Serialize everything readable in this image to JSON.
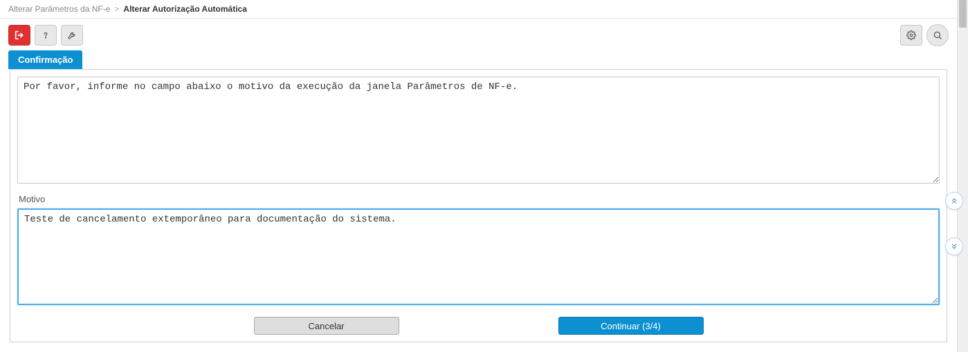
{
  "breadcrumb": {
    "parent": "Alterar Parâmetros da NF-e",
    "current": "Alterar Autorização Automática"
  },
  "toolbar": {
    "icons": {
      "exit": "exit-icon",
      "help": "help-icon",
      "wrench": "wrench-icon",
      "gear": "gear-icon",
      "search": "search-icon"
    }
  },
  "tab": {
    "label": "Confirmação"
  },
  "panel": {
    "instructions_value": "Por favor, informe no campo abaixo o motivo da execução da janela Parâmetros de NF-e.",
    "motivo_label": "Motivo",
    "motivo_value": "Teste de cancelamento extemporâneo para documentação do sistema.",
    "cancel_label": "Cancelar",
    "continue_label": "Continuar (3/4)"
  }
}
